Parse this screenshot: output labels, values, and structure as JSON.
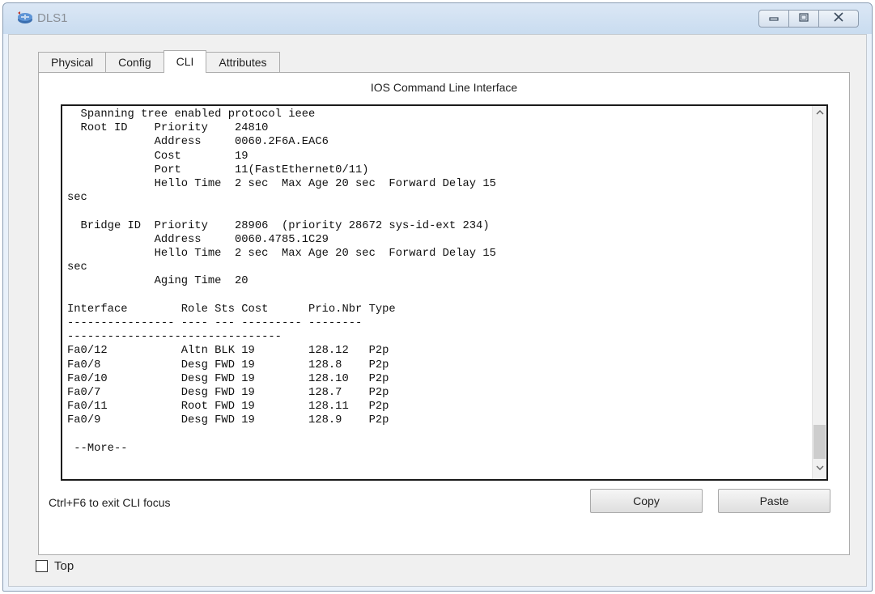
{
  "window": {
    "title": "DLS1"
  },
  "tabs": [
    {
      "label": "Physical"
    },
    {
      "label": "Config"
    },
    {
      "label": "CLI"
    },
    {
      "label": "Attributes"
    }
  ],
  "active_tab": "CLI",
  "cli": {
    "heading": "IOS Command Line Interface",
    "output": "  Spanning tree enabled protocol ieee\n  Root ID    Priority    24810\n             Address     0060.2F6A.EAC6\n             Cost        19\n             Port        11(FastEthernet0/11)\n             Hello Time  2 sec  Max Age 20 sec  Forward Delay 15\nsec\n\n  Bridge ID  Priority    28906  (priority 28672 sys-id-ext 234)\n             Address     0060.4785.1C29\n             Hello Time  2 sec  Max Age 20 sec  Forward Delay 15\nsec\n             Aging Time  20\n\nInterface        Role Sts Cost      Prio.Nbr Type\n---------------- ---- --- --------- --------\n--------------------------------\nFa0/12           Altn BLK 19        128.12   P2p\nFa0/8            Desg FWD 19        128.8    P2p\nFa0/10           Desg FWD 19        128.10   P2p\nFa0/7            Desg FWD 19        128.7    P2p\nFa0/11           Root FWD 19        128.11   P2p\nFa0/9            Desg FWD 19        128.9    P2p\n\n --More--",
    "hint": "Ctrl+F6 to exit CLI focus",
    "copy_label": "Copy",
    "paste_label": "Paste"
  },
  "footer": {
    "top_label": "Top",
    "top_checked": false
  },
  "icons": {
    "app": "router-icon",
    "minimize": "minimize-icon",
    "maximize": "maximize-icon",
    "close": "close-icon",
    "scroll_up": "chevron-up-icon",
    "scroll_down": "chevron-down-icon"
  }
}
